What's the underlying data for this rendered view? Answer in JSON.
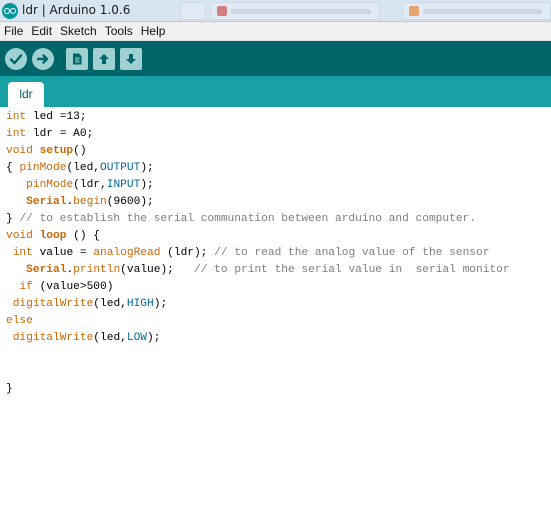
{
  "window": {
    "title": "ldr | Arduino 1.0.6"
  },
  "menu": [
    "File",
    "Edit",
    "Sketch",
    "Tools",
    "Help"
  ],
  "toolbar": {
    "buttons": [
      "verify-button",
      "upload-button",
      "new-button",
      "open-button",
      "save-button"
    ]
  },
  "tabs": [
    {
      "label": "ldr"
    }
  ],
  "colors": {
    "toolbar": "#006468",
    "tabbar": "#17a1a5",
    "keyword": "#cc6600",
    "constant": "#006699",
    "comment": "#7e7e7e"
  },
  "code": {
    "l1": [
      "int",
      " led =13;"
    ],
    "l2": [
      "int",
      " ldr = A0;"
    ],
    "l3": [
      "void",
      " ",
      "setup",
      "()"
    ],
    "l4": [
      "{ ",
      "pinMode",
      "(led,",
      "OUTPUT",
      ");"
    ],
    "l5": [
      "   ",
      "pinMode",
      "(ldr,",
      "INPUT",
      ");"
    ],
    "l6": [
      "   ",
      "Serial",
      ".",
      "begin",
      "(9600);"
    ],
    "l7": [
      "} ",
      "// to establish the serial communation between arduino and computer."
    ],
    "l8": [
      "void",
      " ",
      "loop",
      " () {"
    ],
    "l9": [
      " ",
      "int",
      " value = ",
      "analogRead",
      " (ldr); ",
      "// to read the analog value of the sensor"
    ],
    "l10": [
      "   ",
      "Serial",
      ".",
      "println",
      "(value);   ",
      "// to print the serial value in  serial monitor"
    ],
    "l11": [
      "  ",
      "if",
      " (value>500)"
    ],
    "l12": [
      " ",
      "digitalWrite",
      "(led,",
      "HIGH",
      ");"
    ],
    "l13": [
      "else"
    ],
    "l14": [
      " ",
      "digitalWrite",
      "(led,",
      "LOW",
      ");"
    ],
    "l15": [
      ""
    ],
    "l16": [
      ""
    ],
    "l17": [
      "}"
    ]
  }
}
